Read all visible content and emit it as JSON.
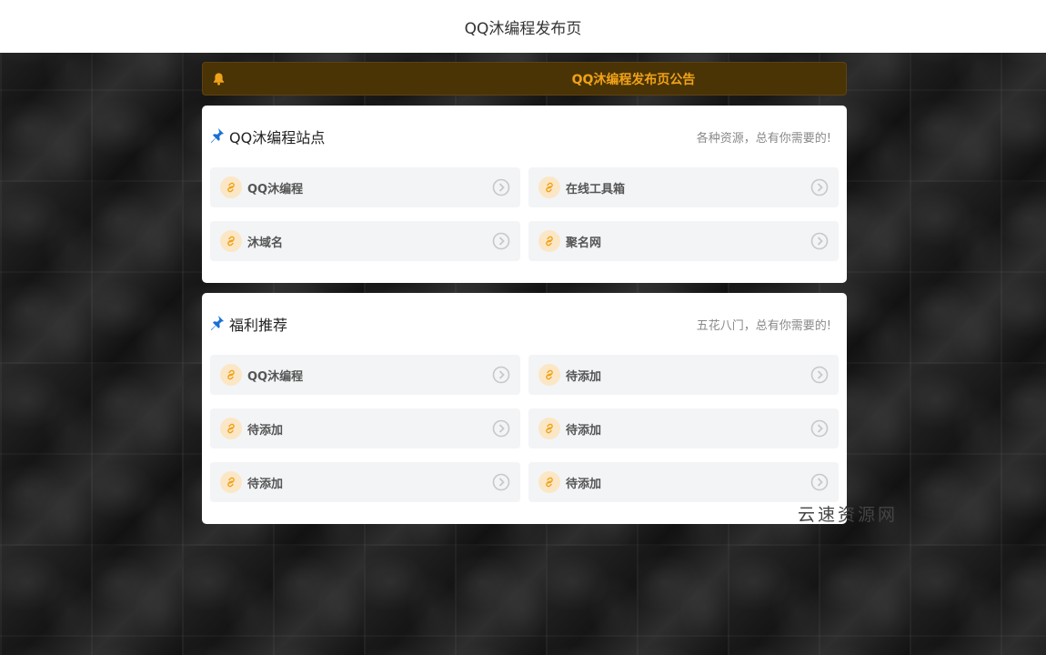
{
  "header": {
    "title": "QQ沐编程发布页"
  },
  "notice": {
    "text": "QQ沐编程发布页公告",
    "icon": "bell-icon",
    "color": "#f0a218"
  },
  "sections": [
    {
      "title": "QQ沐编程站点",
      "subtitle": "各种资源，总有你需要的!",
      "items": [
        {
          "label": "QQ沐编程"
        },
        {
          "label": "在线工具箱"
        },
        {
          "label": "沐域名"
        },
        {
          "label": "聚名网"
        }
      ]
    },
    {
      "title": "福利推荐",
      "subtitle": "五花八门，总有你需要的!",
      "items": [
        {
          "label": "QQ沐编程"
        },
        {
          "label": "待添加"
        },
        {
          "label": "待添加"
        },
        {
          "label": "待添加"
        },
        {
          "label": "待添加"
        },
        {
          "label": "待添加"
        }
      ]
    }
  ],
  "watermark": {
    "text": "云速资源网"
  },
  "colors": {
    "accent": "#f0a218",
    "pin_blue": "#1a6fd6",
    "link_bg": "#fbe7c6"
  }
}
